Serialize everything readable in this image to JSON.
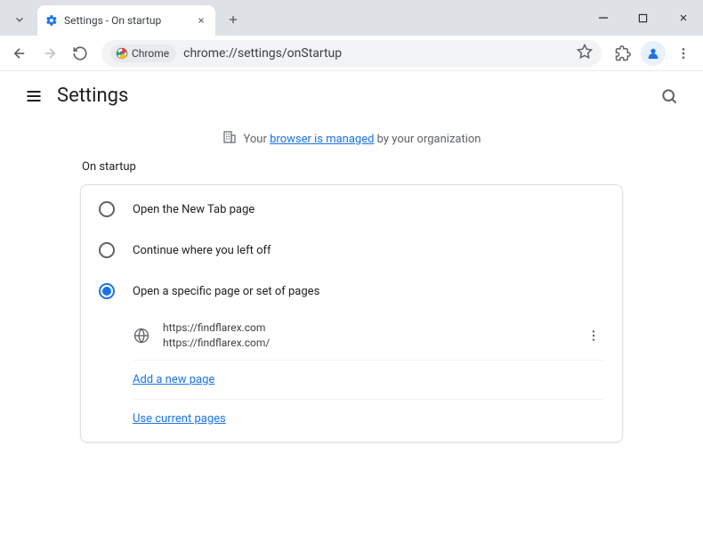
{
  "window": {
    "tab_title": "Settings - On startup"
  },
  "toolbar": {
    "chrome_chip": "Chrome",
    "url": "chrome://settings/onStartup"
  },
  "header": {
    "title": "Settings"
  },
  "banner": {
    "prefix": "Your ",
    "link": "browser is managed",
    "suffix": " by your organization"
  },
  "section": {
    "title": "On startup",
    "options": [
      "Open the New Tab page",
      "Continue where you left off",
      "Open a specific page or set of pages"
    ],
    "startup_page": {
      "title": "https://findflarex.com",
      "url": "https://findflarex.com/"
    },
    "add_page_link": "Add a new page",
    "use_current_link": "Use current pages"
  }
}
